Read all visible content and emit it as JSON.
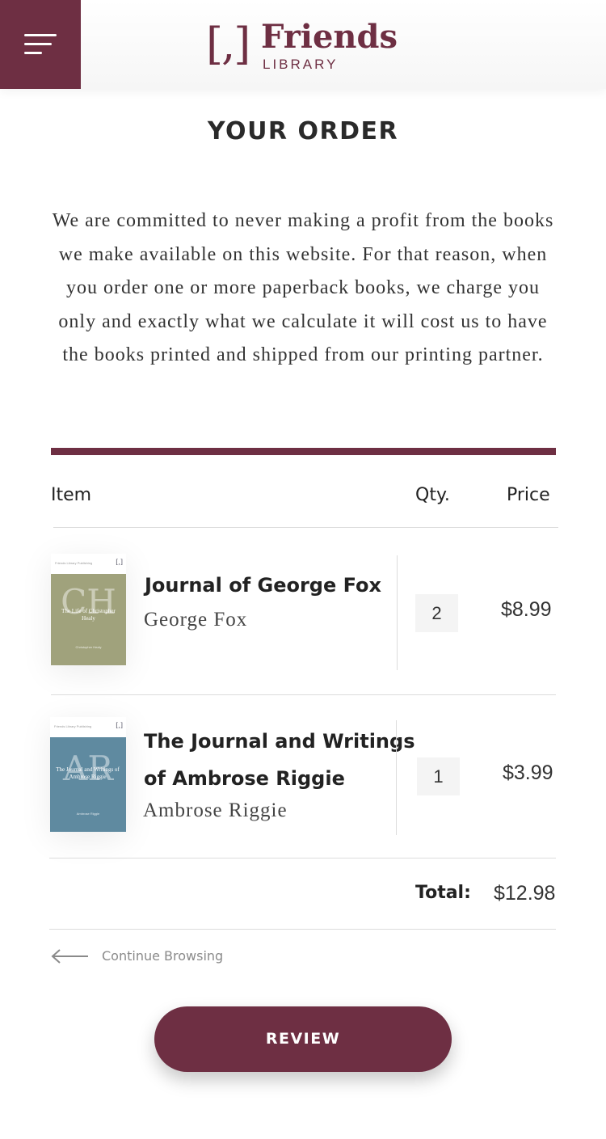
{
  "header": {
    "menu_icon": "hamburger-menu-icon",
    "logo": {
      "mark": "[,]",
      "word": "Friends",
      "sub": "LIBRARY"
    }
  },
  "page": {
    "title": "YOUR ORDER",
    "intro": "We are committed to never making a profit from the books we make available on this website. For that reason, when you order one or more paperback books, we charge you only and exactly what we calculate it will cost us to have the books printed and shipped from our printing partner."
  },
  "table": {
    "headers": {
      "item": "Item",
      "qty": "Qty.",
      "price": "Price"
    },
    "items": [
      {
        "title_lines": [
          "Journal of George Fox"
        ],
        "author": "George Fox",
        "qty": "2",
        "price": "$8.99",
        "cover": {
          "color": "#a0a27c",
          "letters": "CH",
          "title": "The Life of Christopher Healy",
          "author": "Christopher Healy",
          "publisher": "Friends Library Publishing"
        }
      },
      {
        "title_lines": [
          "The Journal and Writings",
          "of Ambrose Riggie"
        ],
        "author": "Ambrose Riggie",
        "qty": "1",
        "price": "$3.99",
        "cover": {
          "color": "#5f8aa0",
          "letters": "AR",
          "title": "The Journal and Writings of Ambrose Riggie",
          "author": "Ambrose Riggie",
          "publisher": "Friends Library Publishing"
        }
      }
    ],
    "total_label": "Total:",
    "total_value": "$12.98"
  },
  "actions": {
    "continue_label": "Continue Browsing",
    "continue_icon": "arrow-left-icon",
    "review_label": "REVIEW"
  },
  "colors": {
    "brand": "#6e2f43",
    "qty_bg": "#f4f4f4",
    "rule": "#dcdcdc"
  }
}
